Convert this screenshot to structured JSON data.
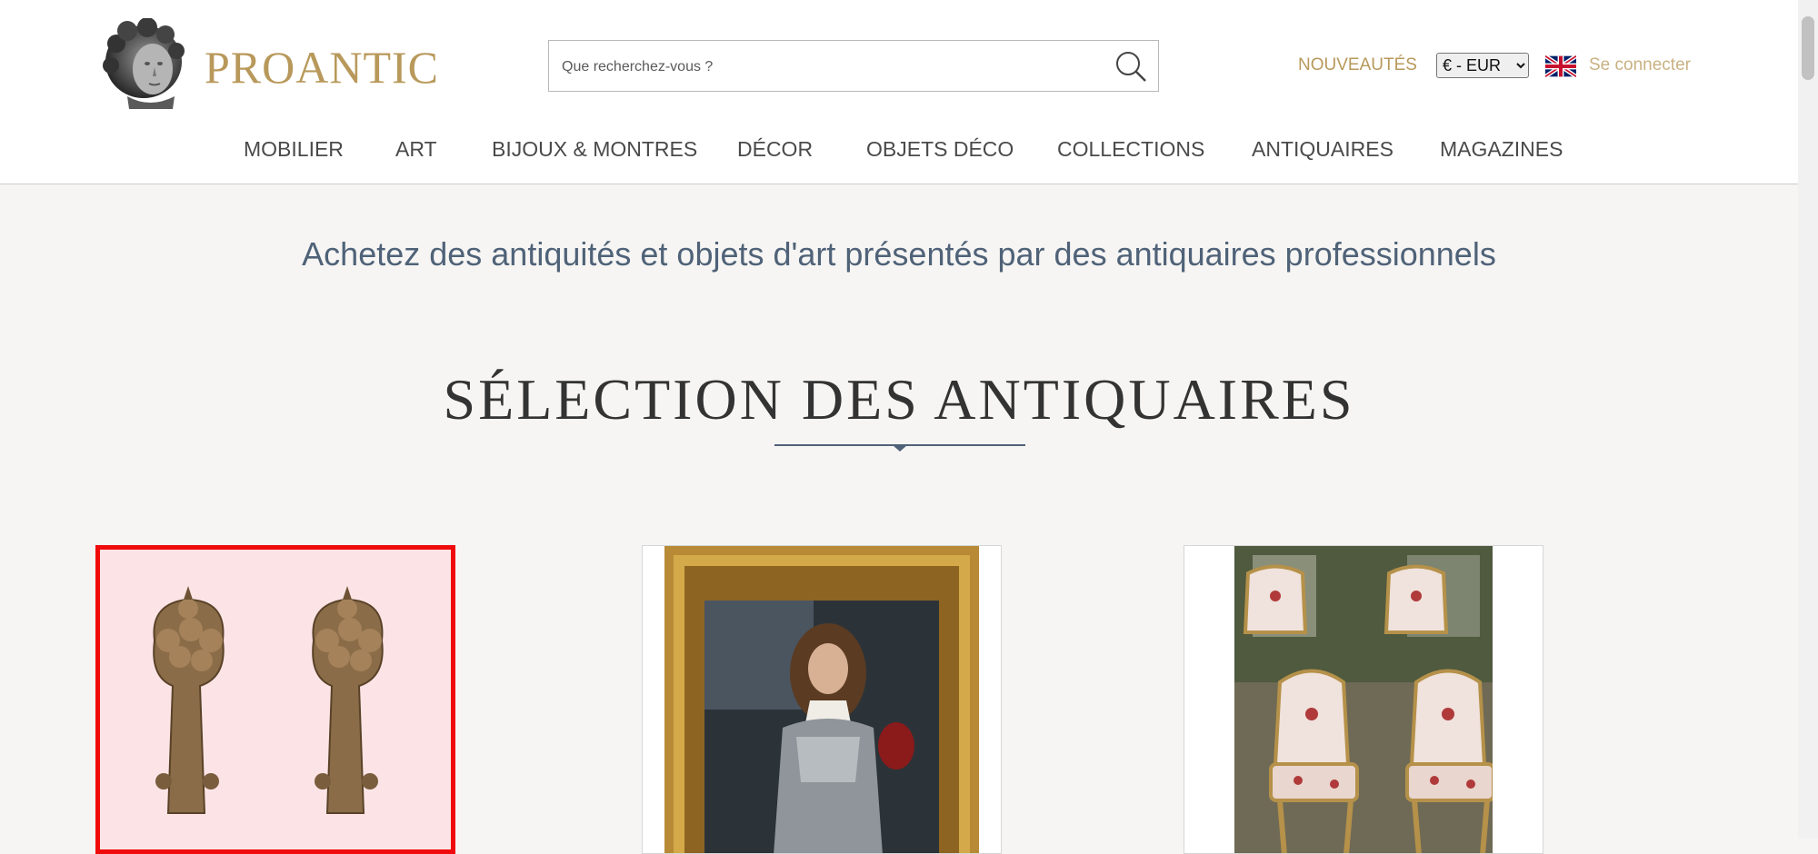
{
  "header": {
    "logo_text": "PROANTIC",
    "search_placeholder": "Que recherchez-vous ?",
    "nouveautes": "NOUVEAUTÉS",
    "currency_selected": "€ - EUR",
    "login": "Se connecter",
    "nav": [
      "MOBILIER",
      "ART",
      "BIJOUX & MONTRES",
      "DÉCOR",
      "OBJETS DÉCO",
      "COLLECTIONS",
      "ANTIQUAIRES",
      "MAGAZINES"
    ]
  },
  "main": {
    "tagline": "Achetez des antiquités et objets d'art présentés par des antiquaires professionnels",
    "section_title": "SÉLECTION DES ANTIQUAIRES"
  },
  "products": [
    {
      "image": "pair-of-carved-fruit-finials",
      "selected": true
    },
    {
      "image": "portrait-painting-in-gilt-frame",
      "selected": false
    },
    {
      "image": "set-of-upholstered-gilt-chairs",
      "selected": false
    }
  ],
  "colors": {
    "brand_gold": "#b8995b",
    "tagline_blue": "#4f6278",
    "selection_red": "#ef0b0b"
  },
  "icons": [
    "bust-logo-icon",
    "search-icon",
    "uk-flag-icon"
  ]
}
